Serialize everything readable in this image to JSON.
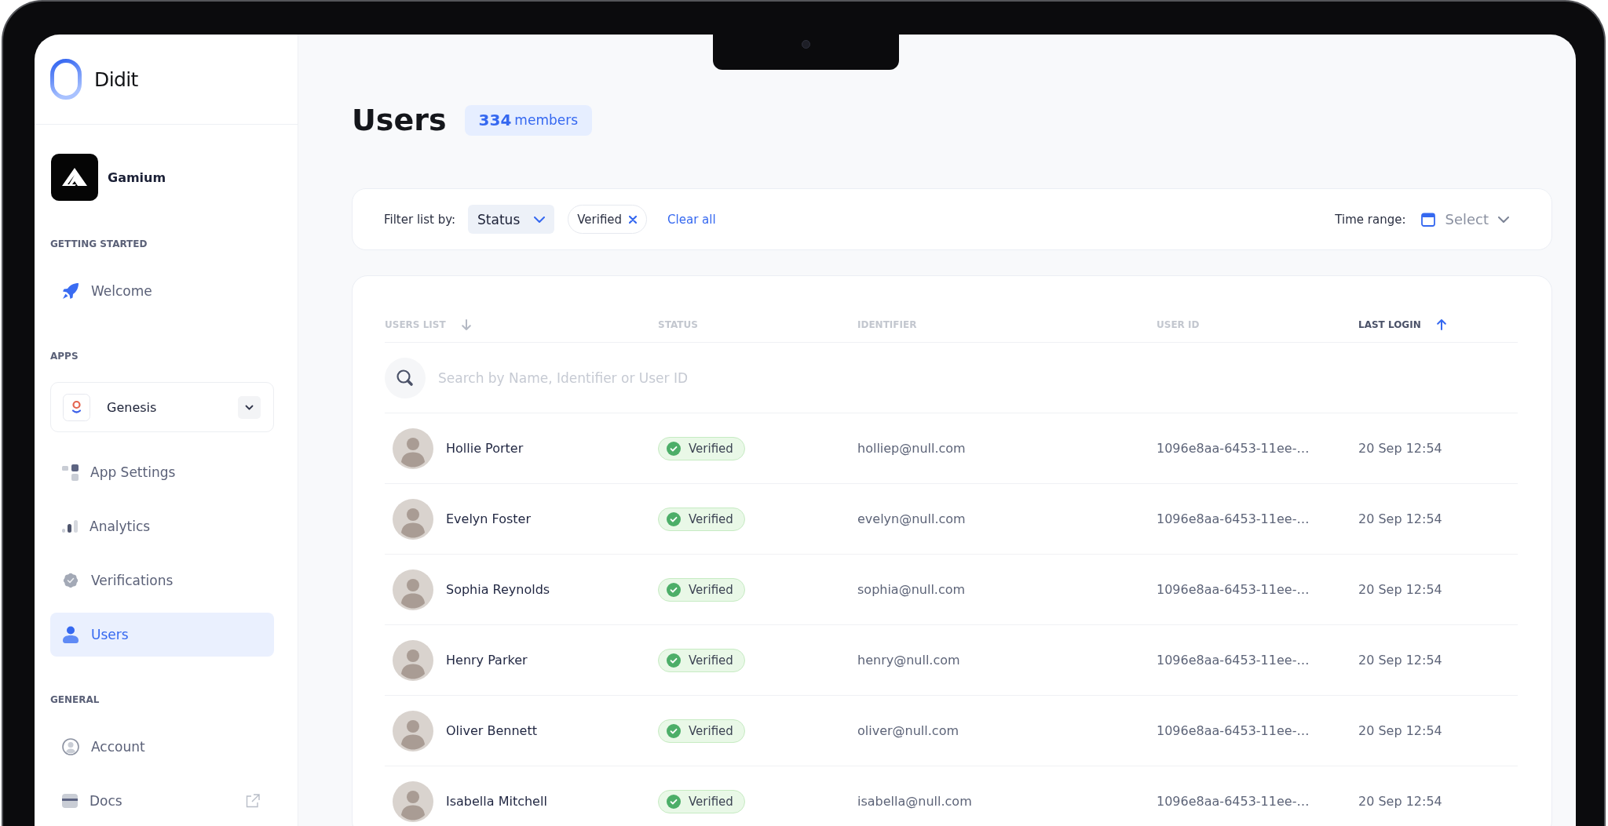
{
  "sidebar": {
    "brand": "Didit",
    "organization": "Gamium",
    "sections": [
      {
        "title": "GETTING STARTED",
        "items": [
          {
            "label": "Welcome",
            "selected": false,
            "external": false
          }
        ]
      },
      {
        "title": "APPS",
        "app_select": {
          "value": "Genesis"
        },
        "items": [
          {
            "label": "App Settings",
            "selected": false,
            "external": false
          },
          {
            "label": "Analytics",
            "selected": false,
            "external": false
          },
          {
            "label": "Verifications",
            "selected": false,
            "external": false
          },
          {
            "label": "Users",
            "selected": true,
            "external": false
          }
        ]
      },
      {
        "title": "GENERAL",
        "items": [
          {
            "label": "Account",
            "selected": false,
            "external": false
          },
          {
            "label": "Docs",
            "selected": false,
            "external": true
          }
        ]
      }
    ]
  },
  "header": {
    "title": "Users",
    "count_badge": "**334** members"
  },
  "filters": {
    "label": "Filter list by:",
    "field": {
      "value": "Status"
    },
    "chips": [
      {
        "label": "Verified"
      }
    ],
    "clear_label": "Clear all",
    "time_range": {
      "label": "Time range:",
      "placeholder": "Select"
    }
  },
  "table": {
    "columns": [
      {
        "label": "USERS LIST",
        "sorted": true,
        "ascending": false,
        "selected": false
      },
      {
        "label": "STATUS",
        "sorted": false,
        "selected": false
      },
      {
        "label": "IDENTIFIER",
        "sorted": false,
        "selected": false
      },
      {
        "label": "USER ID",
        "sorted": false,
        "selected": false
      },
      {
        "label": "LAST LOGIN",
        "sorted": true,
        "ascending": true,
        "selected": true
      }
    ],
    "search": {
      "placeholder": "Search by Name, Identifier or User ID"
    },
    "rows": [
      {
        "name": "Hollie Porter",
        "status": "Verified",
        "identifier": "holliep@null.com",
        "user_id": "1096e8aa-6453-11ee-…",
        "last_login": "20 Sep 12:54"
      },
      {
        "name": "Evelyn Foster",
        "status": "Verified",
        "identifier": "evelyn@null.com",
        "user_id": "1096e8aa-6453-11ee-…",
        "last_login": "20 Sep 12:54"
      },
      {
        "name": "Sophia Reynolds",
        "status": "Verified",
        "identifier": "sophia@null.com",
        "user_id": "1096e8aa-6453-11ee-…",
        "last_login": "20 Sep 12:54"
      },
      {
        "name": "Henry Parker",
        "status": "Verified",
        "identifier": "henry@null.com",
        "user_id": "1096e8aa-6453-11ee-…",
        "last_login": "20 Sep 12:54"
      },
      {
        "name": "Oliver Bennett",
        "status": "Verified",
        "identifier": "oliver@null.com",
        "user_id": "1096e8aa-6453-11ee-…",
        "last_login": "20 Sep 12:54"
      },
      {
        "name": "Isabella Mitchell",
        "status": "Verified",
        "identifier": "isabella@null.com",
        "user_id": "1096e8aa-6453-11ee-…",
        "last_login": "20 Sep 12:54"
      }
    ]
  }
}
